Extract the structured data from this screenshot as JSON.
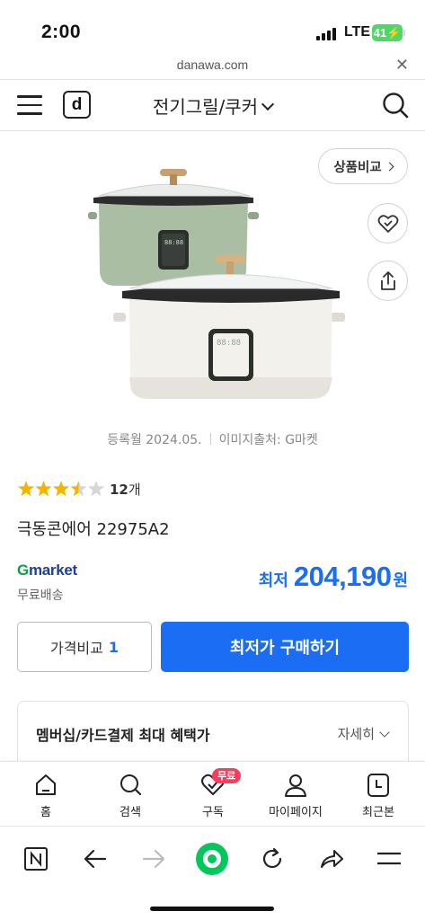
{
  "status_bar": {
    "time": "2:00",
    "network": "LTE",
    "battery": "41"
  },
  "browser": {
    "url": "danawa.com"
  },
  "header": {
    "logo": "d",
    "category": "전기그릴/쿠커"
  },
  "product": {
    "compare_button": "상품비교",
    "registered": "등록월 2024.05.",
    "image_source": "이미지출처: G마켓",
    "rating": 3.5,
    "review_count": "12",
    "review_unit": "개",
    "name": "극동콘에어 22975A2",
    "seller_g": "G",
    "seller_rest": "market",
    "shipping": "무료배송",
    "price_label": "최저",
    "price": "204,190",
    "price_unit": "원",
    "compare_label": "가격비교",
    "compare_count": "1",
    "buy_label": "최저가 구매하기",
    "benefit_title": "멤버십/카드결제 최대 혜택가",
    "benefit_more": "자세히"
  },
  "tabs": [
    {
      "label": "홈",
      "icon": "home-icon"
    },
    {
      "label": "검색",
      "icon": "search-icon"
    },
    {
      "label": "구독",
      "icon": "heart-icon",
      "badge": "무료"
    },
    {
      "label": "마이페이지",
      "icon": "person-icon"
    },
    {
      "label": "최근본",
      "icon": "recent-icon"
    }
  ],
  "colors": {
    "accent": "#1b6ef3",
    "gmarket_green": "#0aa14a",
    "badge": "#ff3b5c",
    "battery": "#4cd964",
    "naver_green": "#03c75a"
  }
}
